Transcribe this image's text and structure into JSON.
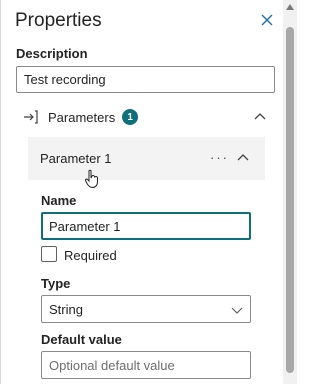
{
  "panel": {
    "title": "Properties",
    "description_label": "Description",
    "description_value": "Test recording",
    "parameters_label": "Parameters",
    "parameters_count": "1",
    "parameter": {
      "header": "Parameter 1",
      "more": "···",
      "name_label": "Name",
      "name_value": "Parameter 1",
      "required_label": "Required",
      "required_checked": false,
      "type_label": "Type",
      "type_value": "String",
      "default_label": "Default value",
      "default_placeholder": "Optional default value"
    }
  },
  "icons": {
    "close": "close-icon",
    "parameters": "sign-in-arrow-icon",
    "collapse": "chevron-up-icon",
    "dropdown": "chevron-down-icon",
    "cursor": "hand-pointer-icon"
  },
  "colors": {
    "accent": "#0f6f7a",
    "close": "#1a6fb8",
    "header_bg": "#f3f3f3"
  }
}
